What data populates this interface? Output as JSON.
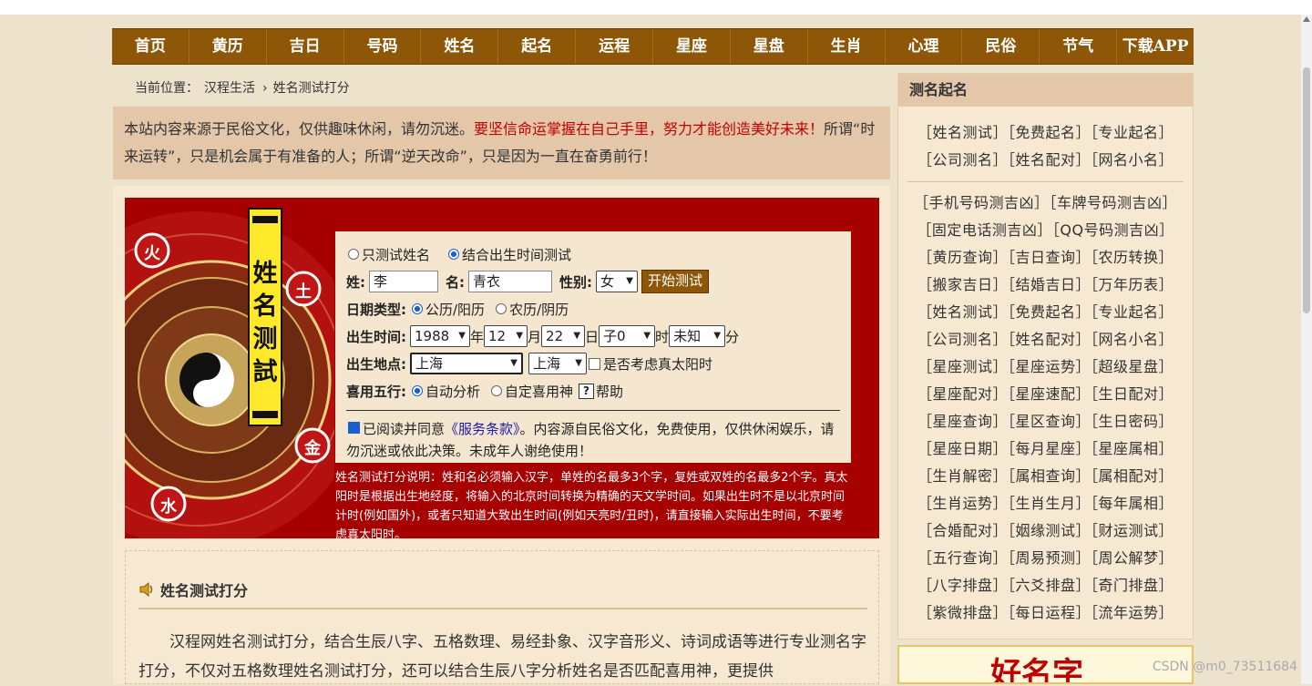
{
  "nav": [
    "首页",
    "黄历",
    "吉日",
    "号码",
    "姓名",
    "起名",
    "运程",
    "星座",
    "星盘",
    "生肖",
    "心理",
    "民俗",
    "节气",
    "下载APP"
  ],
  "breadcrumb": {
    "prefix": "当前位置：",
    "home": "汉程生活",
    "sep": "›",
    "current": "姓名测试打分"
  },
  "notice": {
    "normal1": "本站内容来源于民俗文化，仅供趣味休闲，请勿沉迷。",
    "red": "要坚信命运掌握在自己手里，努力才能创造美好未来！",
    "normal2": "所谓“时来运转”，只是机会属于有准备的人；所谓“逆天改命”，只是因为一直在奋勇前行！"
  },
  "banner": {
    "vertical_title": "姓名测試",
    "elements": [
      "火",
      "土",
      "金",
      "水"
    ]
  },
  "form": {
    "mode_name_only": "只测试姓名",
    "mode_with_birth": "结合出生时间测试",
    "surname_label": "姓:",
    "surname_value": "李",
    "name_label": "名:",
    "name_value": "青衣",
    "gender_label": "性别:",
    "gender_value": "女",
    "start_button": "开始测试",
    "date_type_label": "日期类型:",
    "solar": "公历/阳历",
    "lunar": "农历/阴历",
    "birth_time_label": "出生时间:",
    "year": "1988",
    "year_unit": "年",
    "month": "12",
    "month_unit": "月",
    "day": "22",
    "day_unit": "日",
    "hour": "子0",
    "hour_unit": "时",
    "minute": "未知",
    "minute_unit": "分",
    "birth_place_label": "出生地点:",
    "province": "上海",
    "city": "上海",
    "solar_time_check": "是否考虑真太阳时",
    "wuxing_label": "喜用五行:",
    "auto": "自动分析",
    "custom": "自定喜用神",
    "help_icon": "?",
    "help": "帮助",
    "agree_pre": "已阅读并同意",
    "agree_link": "《服务条款》",
    "agree_post": "。内容源自民俗文化，免费使用，仅供休闲娱乐，请勿沉迷或依此决策。未成年人谢绝使用！"
  },
  "description": "姓名测试打分说明：姓和名必须输入汉字，单姓的名最多3个字，复姓或双姓的名最多2个字。真太阳时是根据出生地经度，将输入的北京时间转换为精确的天文学时间。如果出生时不是以北京时间计时(例如国外)，或者只知道大致出生时间(例如天亮时/丑时)，请直接输入实际出生时间，不要考虑真太阳时。",
  "article": {
    "title": "姓名测试打分",
    "body": "汉程网姓名测试打分，结合生辰八字、五格数理、易经卦象、汉字音形义、诗词成语等进行专业测名字打分，不仅对五格数理姓名测试打分，还可以结合生辰八字分析姓名是否匹配喜用神，更提供"
  },
  "sidebar": {
    "title": "测名起名",
    "top_rows": [
      [
        "［姓名测试］",
        "［免费起名］",
        "［专业起名］"
      ],
      [
        "［公司测名］",
        "［姓名配对］",
        "［网名小名］"
      ]
    ],
    "rows": [
      [
        "［手机号码测吉凶］",
        "［车牌号码测吉凶］"
      ],
      [
        "［固定电话测吉凶］",
        "［QQ号码测吉凶］"
      ],
      [
        "［黄历查询］",
        "［吉日查询］",
        "［农历转换］"
      ],
      [
        "［搬家吉日］",
        "［结婚吉日］",
        "［万年历表］"
      ],
      [
        "［姓名测试］",
        "［免费起名］",
        "［专业起名］"
      ],
      [
        "［公司测名］",
        "［姓名配对］",
        "［网名小名］"
      ],
      [
        "［星座测试］",
        "［星座运势］",
        "［超级星盘］"
      ],
      [
        "［星座配对］",
        "［星座速配］",
        "［生日配对］"
      ],
      [
        "［星座查询］",
        "［星区查询］",
        "［生日密码］"
      ],
      [
        "［星座日期］",
        "［每月星座］",
        "［星座属相］"
      ],
      [
        "［生肖解密］",
        "［属相查询］",
        "［属相配对］"
      ],
      [
        "［生肖运势］",
        "［生肖生月］",
        "［每年属相］"
      ],
      [
        "［合婚配对］",
        "［姻缘测试］",
        "［财运测试］"
      ],
      [
        "［五行查询］",
        "［周易预测］",
        "［周公解梦］"
      ],
      [
        "［八字排盘］",
        "［六爻排盘］",
        "［奇门排盘］"
      ],
      [
        "［紫微排盘］",
        "［每日运程］",
        "［流年运势］"
      ]
    ]
  },
  "ad_text": "好名字",
  "watermark": "CSDN @m0_73511684",
  "colors": {
    "nav": "#8e5607",
    "banner": "#a70000",
    "accent_red": "#c00000",
    "link": "#1a1aa8"
  }
}
